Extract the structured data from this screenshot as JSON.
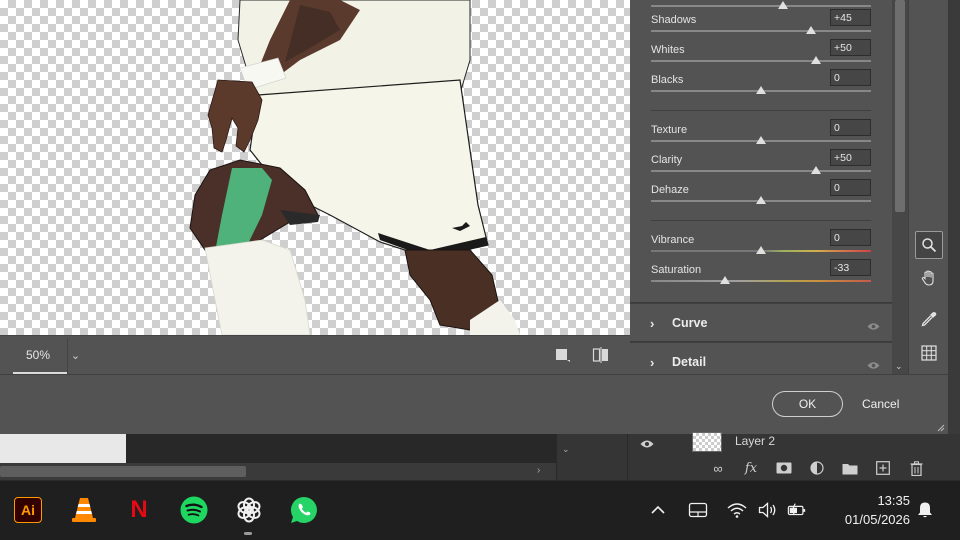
{
  "zoom": {
    "value": "50%"
  },
  "basic_sliders": [
    {
      "label": "Shadows",
      "value": "+45",
      "position": 0.727
    },
    {
      "label": "Whites",
      "value": "+50",
      "position": 0.75
    },
    {
      "label": "Blacks",
      "value": "0",
      "position": 0.5
    }
  ],
  "presence_sliders": [
    {
      "label": "Texture",
      "value": "0",
      "position": 0.5
    },
    {
      "label": "Clarity",
      "value": "+50",
      "position": 0.75
    },
    {
      "label": "Dehaze",
      "value": "0",
      "position": 0.5
    }
  ],
  "color_sliders": [
    {
      "label": "Vibrance",
      "value": "0",
      "position": 0.5
    },
    {
      "label": "Saturation",
      "value": "-33",
      "position": 0.335
    }
  ],
  "sections": [
    {
      "label": "Curve"
    },
    {
      "label": "Detail"
    }
  ],
  "dialog": {
    "ok_label": "OK",
    "cancel_label": "Cancel"
  },
  "layers": {
    "layer_name": "Layer 2"
  },
  "taskbar": {
    "apps": [
      "adobe-illustrator",
      "vlc",
      "netflix",
      "spotify",
      "chatgpt",
      "whatsapp"
    ],
    "illustrator_label": "Ai",
    "netflix_label": "N",
    "time": "13:35",
    "date": "01/05/2026"
  },
  "colors": {
    "panel_bg": "#535353",
    "taskbar_bg": "#1f1f1f",
    "netflix_red": "#e50914",
    "spotify_green": "#1ed760",
    "whatsapp_green": "#25d366",
    "illustrator_orange": "#ff9a00"
  }
}
